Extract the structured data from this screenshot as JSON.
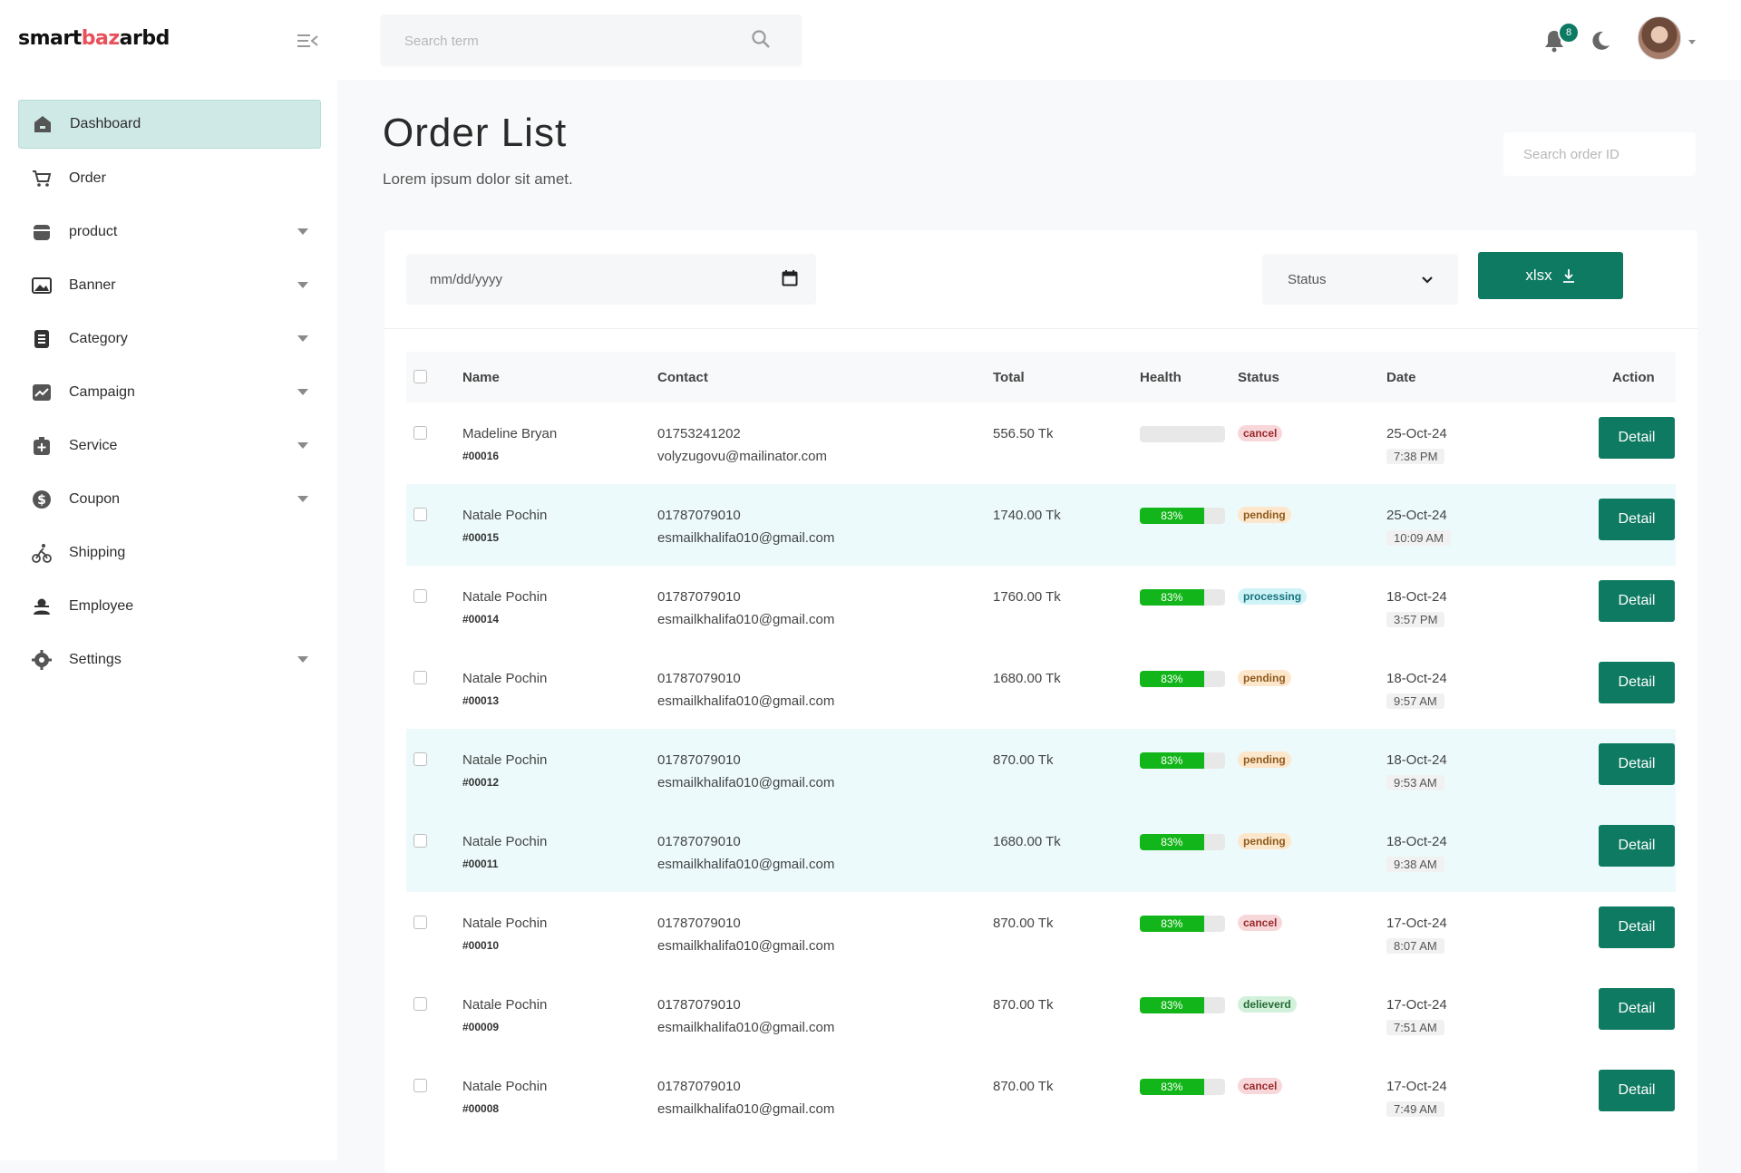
{
  "brand": {
    "logo_pre": "smart",
    "logo_accent": "baz",
    "logo_post": "arbd"
  },
  "sidebar": {
    "items": [
      {
        "label": "Dashboard",
        "icon": "home-icon",
        "active": true,
        "caret": false
      },
      {
        "label": "Order",
        "icon": "cart-icon",
        "active": false,
        "caret": false
      },
      {
        "label": "product",
        "icon": "box-icon",
        "active": false,
        "caret": true
      },
      {
        "label": "Banner",
        "icon": "image-icon",
        "active": false,
        "caret": true
      },
      {
        "label": "Category",
        "icon": "list-icon",
        "active": false,
        "caret": true
      },
      {
        "label": "Campaign",
        "icon": "chart-icon",
        "active": false,
        "caret": true
      },
      {
        "label": "Service",
        "icon": "service-icon",
        "active": false,
        "caret": true
      },
      {
        "label": "Coupon",
        "icon": "dollar-icon",
        "active": false,
        "caret": true
      },
      {
        "label": "Shipping",
        "icon": "bike-icon",
        "active": false,
        "caret": false
      },
      {
        "label": "Employee",
        "icon": "user-icon",
        "active": false,
        "caret": false
      },
      {
        "label": "Settings",
        "icon": "gear-icon",
        "active": false,
        "caret": true
      }
    ]
  },
  "topbar": {
    "search_placeholder": "Search term",
    "notification_count": "8"
  },
  "page": {
    "title": "Order List",
    "subtitle": "Lorem ipsum dolor sit amet.",
    "order_search_placeholder": "Search order ID"
  },
  "filters": {
    "date_placeholder": "mm/dd/yyyy",
    "status_label": "Status",
    "export_label": "xlsx"
  },
  "table": {
    "headers": {
      "name": "Name",
      "contact": "Contact",
      "total": "Total",
      "health": "Health",
      "status": "Status",
      "date": "Date",
      "action": "Action"
    },
    "detail_label": "Detail",
    "rows": [
      {
        "name": "Madeline Bryan",
        "id": "#00016",
        "phone": "01753241202",
        "email": "volyzugovu@mailinator.com",
        "total": "556.50 Tk",
        "health": "",
        "health_pct": 0,
        "status": "cancel",
        "status_type": "cancel",
        "date": "25-Oct-24",
        "time": "7:38 PM",
        "highlight": false
      },
      {
        "name": "Natale Pochin",
        "id": "#00015",
        "phone": "01787079010",
        "email": "esmailkhalifa010@gmail.com",
        "total": "1740.00 Tk",
        "health": "83%",
        "health_pct": 83,
        "status": "pending",
        "status_type": "pending",
        "date": "25-Oct-24",
        "time": "10:09 AM",
        "highlight": true
      },
      {
        "name": "Natale Pochin",
        "id": "#00014",
        "phone": "01787079010",
        "email": "esmailkhalifa010@gmail.com",
        "total": "1760.00 Tk",
        "health": "83%",
        "health_pct": 83,
        "status": "processing",
        "status_type": "processing",
        "date": "18-Oct-24",
        "time": "3:57 PM",
        "highlight": false
      },
      {
        "name": "Natale Pochin",
        "id": "#00013",
        "phone": "01787079010",
        "email": "esmailkhalifa010@gmail.com",
        "total": "1680.00 Tk",
        "health": "83%",
        "health_pct": 83,
        "status": "pending",
        "status_type": "pending",
        "date": "18-Oct-24",
        "time": "9:57 AM",
        "highlight": false
      },
      {
        "name": "Natale Pochin",
        "id": "#00012",
        "phone": "01787079010",
        "email": "esmailkhalifa010@gmail.com",
        "total": "870.00 Tk",
        "health": "83%",
        "health_pct": 83,
        "status": "pending",
        "status_type": "pending",
        "date": "18-Oct-24",
        "time": "9:53 AM",
        "highlight": true
      },
      {
        "name": "Natale Pochin",
        "id": "#00011",
        "phone": "01787079010",
        "email": "esmailkhalifa010@gmail.com",
        "total": "1680.00 Tk",
        "health": "83%",
        "health_pct": 83,
        "status": "pending",
        "status_type": "pending",
        "date": "18-Oct-24",
        "time": "9:38 AM",
        "highlight": true
      },
      {
        "name": "Natale Pochin",
        "id": "#00010",
        "phone": "01787079010",
        "email": "esmailkhalifa010@gmail.com",
        "total": "870.00 Tk",
        "health": "83%",
        "health_pct": 83,
        "status": "cancel",
        "status_type": "cancel",
        "date": "17-Oct-24",
        "time": "8:07 AM",
        "highlight": false
      },
      {
        "name": "Natale Pochin",
        "id": "#00009",
        "phone": "01787079010",
        "email": "esmailkhalifa010@gmail.com",
        "total": "870.00 Tk",
        "health": "83%",
        "health_pct": 83,
        "status": "delieverd",
        "status_type": "delivered",
        "date": "17-Oct-24",
        "time": "7:51 AM",
        "highlight": false
      },
      {
        "name": "Natale Pochin",
        "id": "#00008",
        "phone": "01787079010",
        "email": "esmailkhalifa010@gmail.com",
        "total": "870.00 Tk",
        "health": "83%",
        "health_pct": 83,
        "status": "cancel",
        "status_type": "cancel",
        "date": "17-Oct-24",
        "time": "7:49 AM",
        "highlight": false
      }
    ]
  },
  "colors": {
    "accent": "#0e7a62",
    "active_nav": "#cfe9e7",
    "row_highlight": "#ecfafb",
    "health_fill": "#13b61a"
  }
}
